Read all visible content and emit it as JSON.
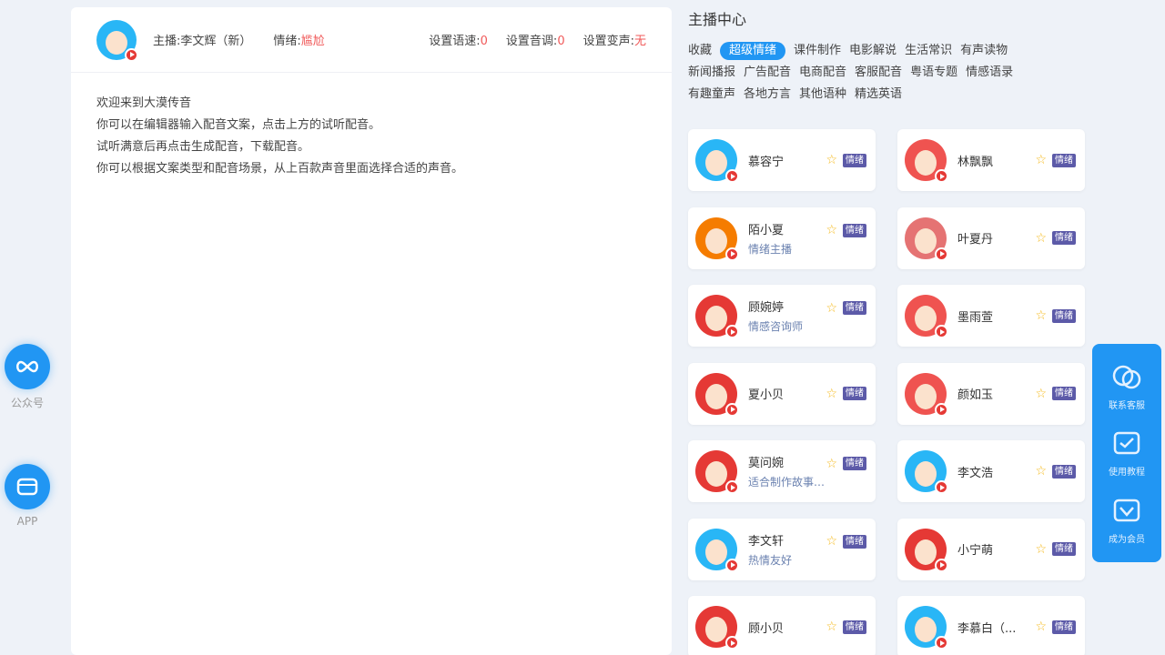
{
  "left_sidebar": [
    {
      "label": "公众号",
      "icon": "infinity-icon"
    },
    {
      "label": "APP",
      "icon": "app-icon"
    }
  ],
  "editor": {
    "anchor_label": "主播:李文辉（新）",
    "emotion_label": "情绪:",
    "emotion_value": "尴尬",
    "settings": [
      {
        "label": "设置语速:",
        "value": "0"
      },
      {
        "label": "设置音调:",
        "value": "0"
      },
      {
        "label": "设置变声:",
        "value": "无"
      }
    ],
    "welcome_lines": [
      "欢迎来到大漠传音",
      "你可以在编辑器输入配音文案，点击上方的试听配音。",
      "试听满意后再点击生成配音，下载配音。",
      "你可以根据文案类型和配音场景，从上百款声音里面选择合适的声音。"
    ]
  },
  "panel": {
    "title": "主播中心",
    "categories": [
      {
        "label": "收藏",
        "active": false
      },
      {
        "label": "超级情绪",
        "active": true
      },
      {
        "label": "课件制作",
        "active": false
      },
      {
        "label": "电影解说",
        "active": false
      },
      {
        "label": "生活常识",
        "active": false
      },
      {
        "label": "有声读物",
        "active": false
      },
      {
        "label": "新闻播报",
        "active": false
      },
      {
        "label": "广告配音",
        "active": false
      },
      {
        "label": "电商配音",
        "active": false
      },
      {
        "label": "客服配音",
        "active": false
      },
      {
        "label": "粤语专题",
        "active": false
      },
      {
        "label": "情感语录",
        "active": false
      },
      {
        "label": "有趣童声",
        "active": false
      },
      {
        "label": "各地方言",
        "active": false
      },
      {
        "label": "其他语种",
        "active": false
      },
      {
        "label": "精选英语",
        "active": false
      }
    ],
    "badge_label": "情绪",
    "anchors": [
      {
        "name": "慕容宁",
        "desc": "",
        "avatar_color": "#29b6f6"
      },
      {
        "name": "林飘飘",
        "desc": "",
        "avatar_color": "#ef5350"
      },
      {
        "name": "陌小夏",
        "desc": "情绪主播",
        "avatar_color": "#f57c00"
      },
      {
        "name": "叶夏丹",
        "desc": "",
        "avatar_color": "#e57373"
      },
      {
        "name": "顾婉婷",
        "desc": "情感咨询师",
        "avatar_color": "#e53935"
      },
      {
        "name": "墨雨萱",
        "desc": "",
        "avatar_color": "#ef5350"
      },
      {
        "name": "夏小贝",
        "desc": "",
        "avatar_color": "#e53935"
      },
      {
        "name": "颜如玉",
        "desc": "",
        "avatar_color": "#ef5350"
      },
      {
        "name": "莫问婉",
        "desc": "适合制作故事音频！",
        "avatar_color": "#e53935"
      },
      {
        "name": "李文浩",
        "desc": "",
        "avatar_color": "#29b6f6"
      },
      {
        "name": "李文轩",
        "desc": "热情友好",
        "avatar_color": "#29b6f6"
      },
      {
        "name": "小宁萌",
        "desc": "",
        "avatar_color": "#e53935"
      },
      {
        "name": "顾小贝",
        "desc": "",
        "avatar_color": "#e53935"
      },
      {
        "name": "李慕白（...",
        "desc": "",
        "avatar_color": "#29b6f6"
      }
    ]
  },
  "float_bar": [
    {
      "label": "联系客服",
      "icon": "chat-icon"
    },
    {
      "label": "使用教程",
      "icon": "tutorial-icon"
    },
    {
      "label": "成为会员",
      "icon": "vip-icon"
    }
  ]
}
